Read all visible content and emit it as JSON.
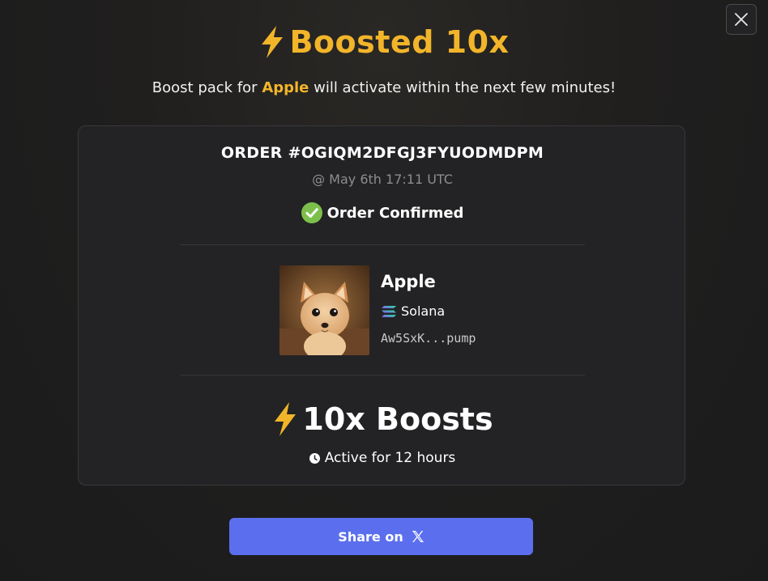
{
  "modal": {
    "title": "Boosted 10x",
    "subtitle_before": "Boost pack for ",
    "token_highlight": "Apple",
    "subtitle_after": " will activate within the next few minutes!",
    "close_icon": "close-icon"
  },
  "order": {
    "id_label": "ORDER #OGIQM2DFGJ3FYUODMDPM",
    "date": "@ May 6th 17:11 UTC",
    "status": "Order Confirmed",
    "status_icon": "check-circle-icon",
    "status_color": "#7cc04b"
  },
  "token": {
    "name": "Apple",
    "chain": "Solana",
    "chain_icon": "solana-icon",
    "address": "Aw5SxK...pump",
    "avatar": "fox-avatar"
  },
  "boost": {
    "label": "10x Boosts",
    "duration": "Active for 12 hours",
    "bolt_icon": "lightning-bolt-icon",
    "clock_icon": "clock-icon"
  },
  "share": {
    "label": "Share on",
    "icon": "x-logo-icon",
    "color": "#5b6fee"
  },
  "colors": {
    "accent": "#f2b52a",
    "background": "#1e1e1f",
    "card": "#232325"
  }
}
